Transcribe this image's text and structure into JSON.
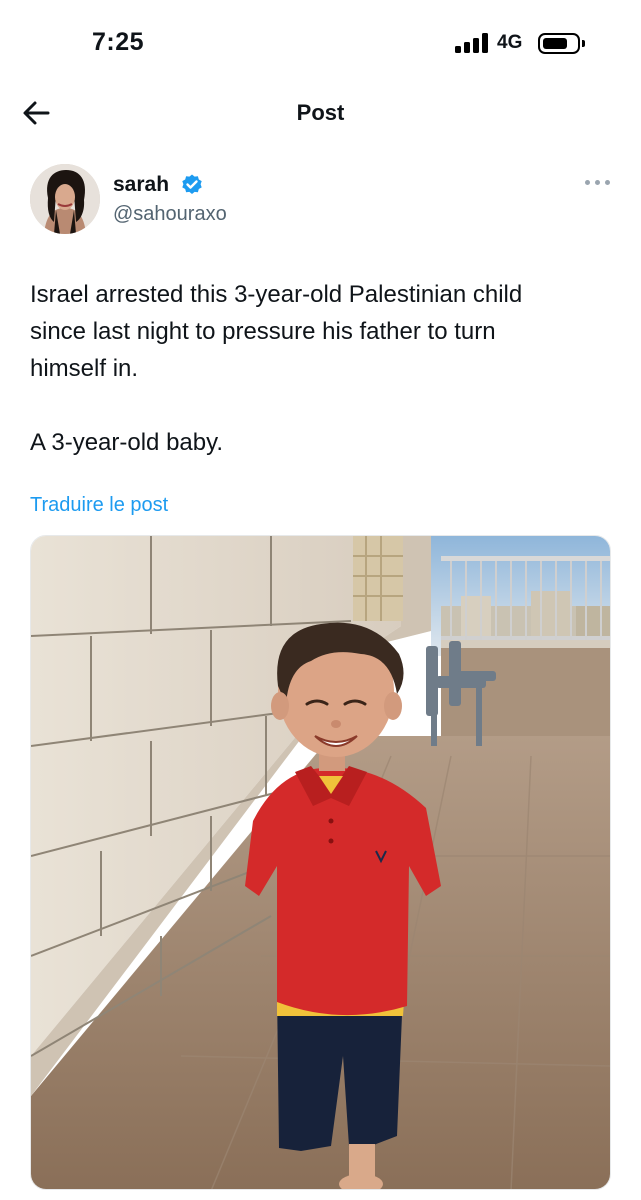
{
  "status_bar": {
    "time": "7:25",
    "network": "4G",
    "signal_icon": "signal-bars-icon",
    "battery_icon": "battery-icon"
  },
  "header": {
    "title": "Post",
    "back_icon": "arrow-left-icon"
  },
  "post": {
    "author": {
      "display_name": "sarah",
      "handle": "@sahouraxo",
      "verified_icon": "verified-badge-icon",
      "avatar_icon": "avatar"
    },
    "more_icon": "more-horizontal-icon",
    "text_paragraph_1": "Israel arrested this 3-year-old Palestinian child\nsince last night to pressure his father to turn\nhimself in.",
    "text_paragraph_2": "A 3-year-old baby.",
    "translate_label": "Traduire le post",
    "media": {
      "kind": "photo",
      "subject": "child-photo"
    }
  },
  "colors": {
    "text": "#0f1419",
    "secondary_text": "#536471",
    "link": "#1d9bf0",
    "verified": "#1d9bf0",
    "shirt": "#d42a2a"
  }
}
